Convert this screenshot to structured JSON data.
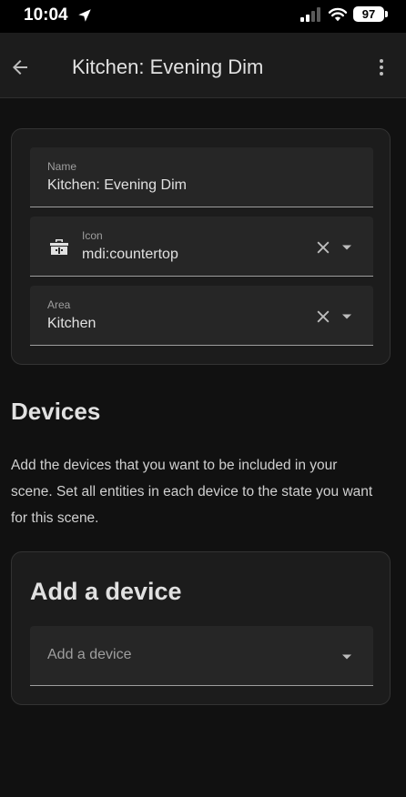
{
  "status_bar": {
    "time": "10:04",
    "battery": "97"
  },
  "app_bar": {
    "title": "Kitchen: Evening Dim",
    "back_icon": "arrow-left-icon",
    "menu_icon": "dots-vertical-icon"
  },
  "scene_form": {
    "name": {
      "label": "Name",
      "value": "Kitchen: Evening Dim"
    },
    "icon": {
      "label": "Icon",
      "value": "mdi:countertop",
      "icon_name": "countertop-icon"
    },
    "area": {
      "label": "Area",
      "value": "Kitchen"
    }
  },
  "devices_section": {
    "heading": "Devices",
    "description": "Add the devices that you want to be included in your scene. Set all entities in each device to the state you want for this scene."
  },
  "add_device_card": {
    "heading": "Add a device",
    "placeholder": "Add a device"
  },
  "colors": {
    "background": "#111111",
    "surface": "#1c1c1c",
    "field": "#262626",
    "text_primary": "#e1e1e1",
    "text_secondary": "#9e9e9e"
  }
}
